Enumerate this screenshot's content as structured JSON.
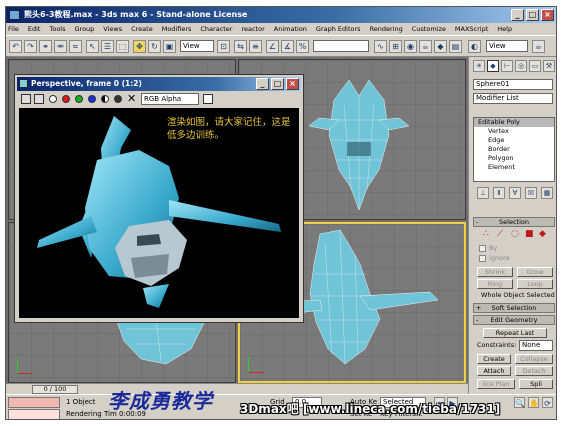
{
  "window": {
    "title": "熊头6-3教程.max  - 3ds max 6 - Stand-alone License"
  },
  "menu": [
    "File",
    "Edit",
    "Tools",
    "Group",
    "Views",
    "Create",
    "Modifiers",
    "Character",
    "reactor",
    "Animation",
    "Graph Editors",
    "Rendering",
    "Customize",
    "MAXScript",
    "Help"
  ],
  "toolbar": {
    "view_select_1": "View",
    "view_select_2": "View"
  },
  "render_window": {
    "title": "Perspective, frame 0 (1:2)",
    "channel": "RGB Alpha",
    "caption": "渲染如图，请大家记住，这是低多边训练。"
  },
  "command_panel": {
    "object_name": "Sphere01",
    "modifier_list": "Modifier List",
    "stack": [
      "Editable Poly",
      "Vertex",
      "Edge",
      "Border",
      "Polygon",
      "Element"
    ],
    "selection": {
      "title": "Selection",
      "by_label": "By",
      "ignore_label": "Ignore",
      "shrink": "Shrink",
      "grow": "Grow",
      "ring": "Ring",
      "loop": "Loop",
      "whole_object": "Whole Object Selected"
    },
    "soft_selection": "Soft Selection",
    "edit_geometry": {
      "title": "Edit Geometry",
      "repeat_last": "Repeat Last",
      "constraints_label": "Constraints:",
      "constraints_value": "None",
      "create": "Create",
      "collapse": "Collapse",
      "attach": "Attach",
      "detach": "Detach",
      "slice_plane": "lice Plan",
      "split": "Spli"
    }
  },
  "time_slider": {
    "frame": "0 / 100"
  },
  "status": {
    "selection": "1 Object",
    "rendering_time": "Rendering Tim  0:00:09",
    "grid_label": "Grid",
    "grid_value": "0.0",
    "auto_key": "Auto Ke",
    "selected": "Selected",
    "set_key": "Set Ke",
    "key_filters": "Key Filters..."
  },
  "watermark": "李成勇教学",
  "url_overlay": "3Dmax吧  [www.lineca.com/tieba/1731]"
}
